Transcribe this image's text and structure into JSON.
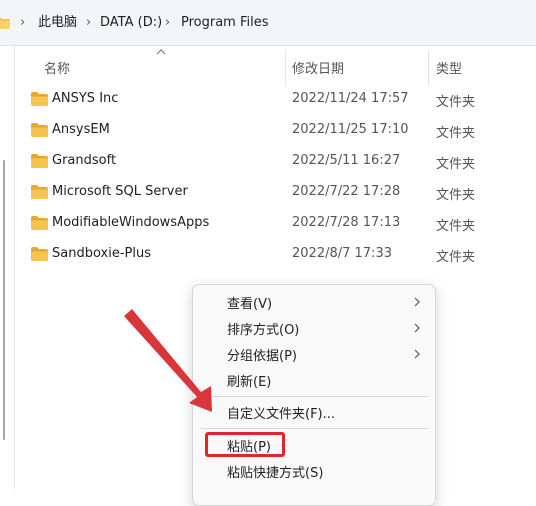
{
  "breadcrumb": {
    "items": [
      "此电脑",
      "DATA (D:)",
      "Program Files"
    ],
    "separator": "›"
  },
  "columns": {
    "name": "名称",
    "date": "修改日期",
    "type": "类型"
  },
  "files": [
    {
      "name": "ANSYS Inc",
      "date": "2022/11/24 17:57",
      "type": "文件夹"
    },
    {
      "name": "AnsysEM",
      "date": "2022/11/25 17:10",
      "type": "文件夹"
    },
    {
      "name": "Grandsoft",
      "date": "2022/5/11 16:27",
      "type": "文件夹"
    },
    {
      "name": "Microsoft SQL Server",
      "date": "2022/7/22 17:28",
      "type": "文件夹"
    },
    {
      "name": "ModifiableWindowsApps",
      "date": "2022/7/28 17:13",
      "type": "文件夹"
    },
    {
      "name": "Sandboxie-Plus",
      "date": "2022/8/7 17:33",
      "type": "文件夹"
    }
  ],
  "context_menu": {
    "view": "查看(V)",
    "sort": "排序方式(O)",
    "group": "分组依据(P)",
    "refresh": "刷新(E)",
    "customize": "自定义文件夹(F)...",
    "paste": "粘贴(P)",
    "paste_shortcut": "粘贴快捷方式(S)"
  },
  "icons": {
    "folder": "folder-icon",
    "sort": "sort-ascending-icon",
    "submenu": "chevron-right-icon",
    "annotation_arrow": "red-arrow-icon"
  },
  "colors": {
    "folder": "#f5c350",
    "folder_dark": "#e6a82e",
    "highlight": "#e0252b",
    "arrow": "#d9363c"
  }
}
